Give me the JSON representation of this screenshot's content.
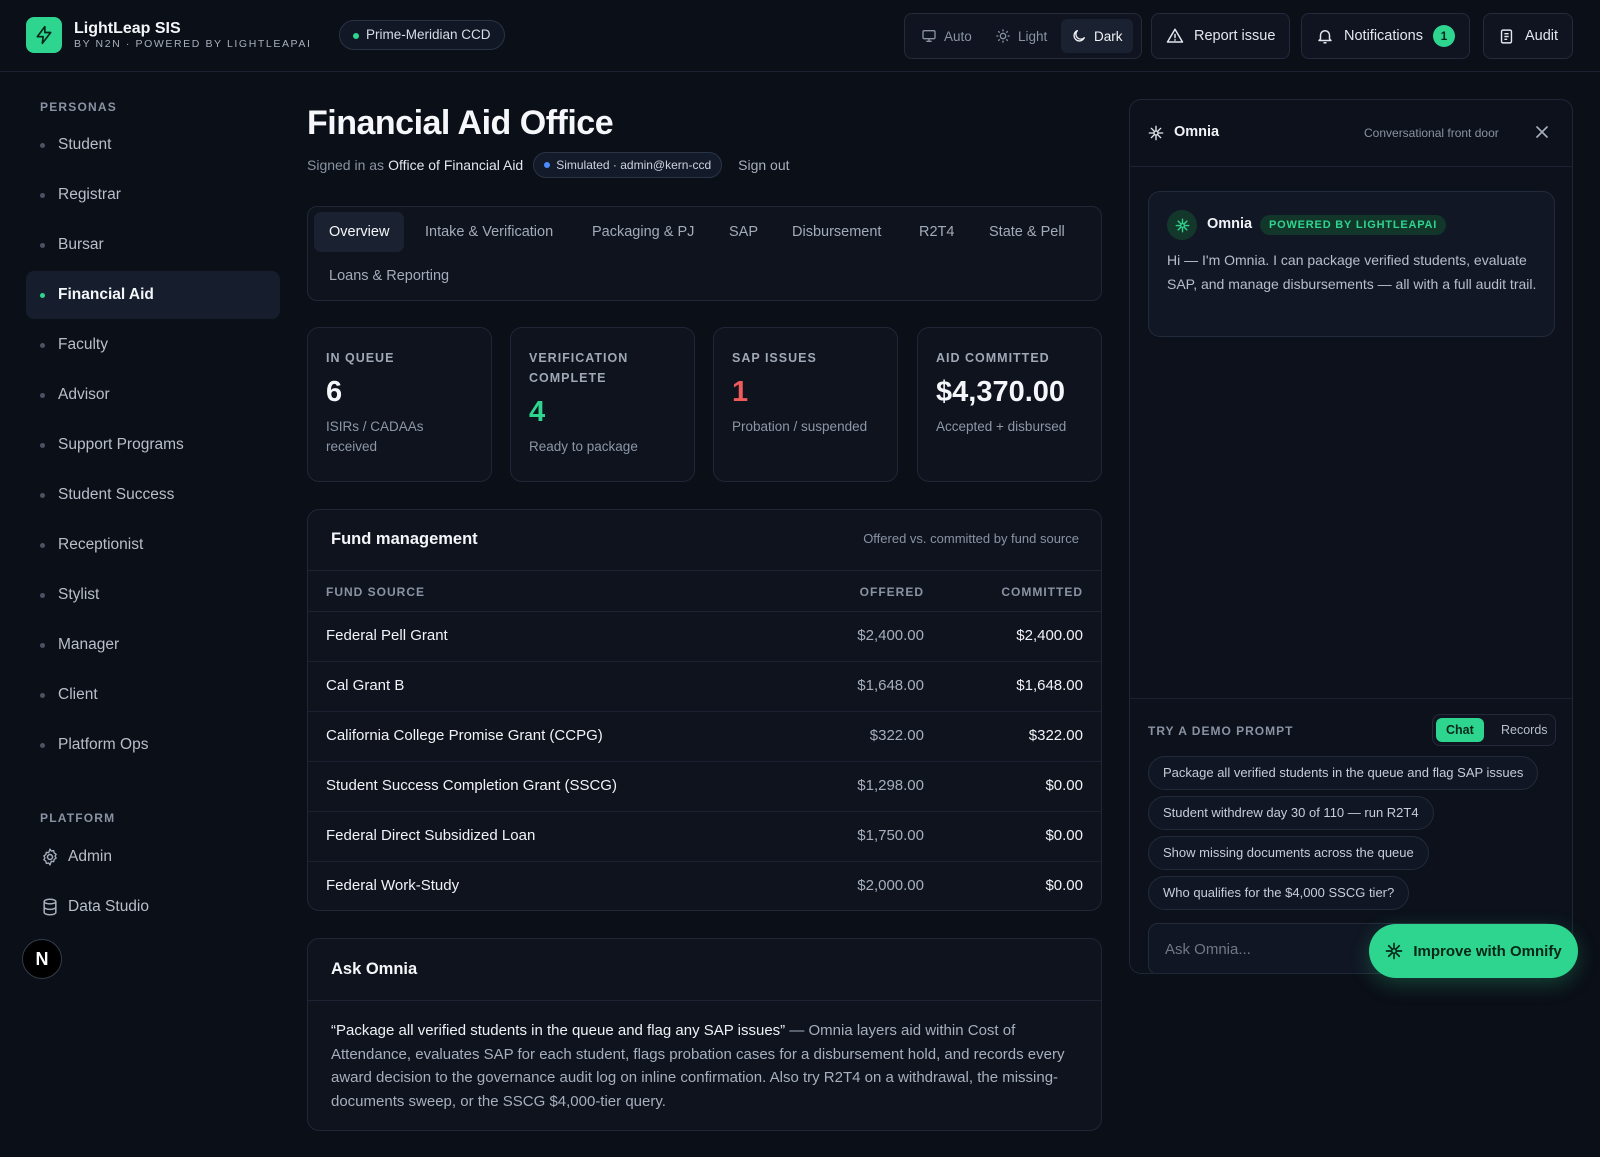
{
  "header": {
    "brand_name": "LightLeap SIS",
    "brand_sub": "BY N2N · POWERED BY LIGHTLEAPAI",
    "tenant": "Prime-Meridian CCD",
    "theme": {
      "auto": "Auto",
      "light": "Light",
      "dark": "Dark",
      "selected": "Dark"
    },
    "report_issue": "Report issue",
    "notifications": "Notifications",
    "notifications_count": "1",
    "audit": "Audit"
  },
  "sidebar": {
    "personas_label": "PERSONAS",
    "personas": [
      "Student",
      "Registrar",
      "Bursar",
      "Financial Aid",
      "Faculty",
      "Advisor",
      "Support Programs",
      "Student Success",
      "Receptionist",
      "Stylist",
      "Manager",
      "Client",
      "Platform Ops"
    ],
    "active": "Financial Aid",
    "platform_label": "PLATFORM",
    "platform": [
      "Admin",
      "Data Studio"
    ],
    "avatar_letter": "N"
  },
  "main": {
    "title": "Financial Aid Office",
    "signed_in_prefix": "Signed in as",
    "signed_in_as": "Office of Financial Aid",
    "simulated": "Simulated · admin@kern-ccd",
    "sign_out": "Sign out",
    "tabs": [
      "Overview",
      "Intake & Verification",
      "Packaging & PJ",
      "SAP",
      "Disbursement",
      "R2T4",
      "State & Pell",
      "Loans & Reporting"
    ],
    "active_tab": "Overview",
    "kpis": [
      {
        "label": "IN QUEUE",
        "value": "6",
        "sub": "ISIRs / CADAAs received"
      },
      {
        "label": "VERIFICATION COMPLETE",
        "value": "4",
        "sub": "Ready to package"
      },
      {
        "label": "SAP ISSUES",
        "value": "1",
        "sub": "Probation / suspended"
      },
      {
        "label": "AID COMMITTED",
        "value": "$4,370.00",
        "sub": "Accepted + disbursed"
      }
    ],
    "fund": {
      "title": "Fund management",
      "note": "Offered vs. committed by fund source",
      "columns": [
        "FUND SOURCE",
        "OFFERED",
        "COMMITTED"
      ],
      "rows": [
        {
          "source": "Federal Pell Grant",
          "offered": "$2,400.00",
          "committed": "$2,400.00"
        },
        {
          "source": "Cal Grant B",
          "offered": "$1,648.00",
          "committed": "$1,648.00"
        },
        {
          "source": "California College Promise Grant (CCPG)",
          "offered": "$322.00",
          "committed": "$322.00"
        },
        {
          "source": "Student Success Completion Grant (SSCG)",
          "offered": "$1,298.00",
          "committed": "$0.00"
        },
        {
          "source": "Federal Direct Subsidized Loan",
          "offered": "$1,750.00",
          "committed": "$0.00"
        },
        {
          "source": "Federal Work-Study",
          "offered": "$2,000.00",
          "committed": "$0.00"
        }
      ]
    },
    "ask": {
      "title": "Ask Omnia",
      "quote": "“Package all verified students in the queue and flag any SAP issues”",
      "body": " — Omnia layers aid within Cost of Attendance, evaluates SAP for each student, flags probation cases for a disbursement hold, and records every award decision to the governance audit log on inline confirmation. Also try R2T4 on a withdrawal, the missing-documents sweep, or the SSCG $4,000-tier query."
    }
  },
  "omnia": {
    "title": "Omnia",
    "note": "Conversational front door",
    "bubble_name": "Omnia",
    "bubble_tag": "POWERED BY LIGHTLEAPAI",
    "bubble_text": "Hi — I'm Omnia. I can package verified students, evaluate SAP, and manage disbursements — all with a full audit trail.",
    "demo_label": "TRY A DEMO PROMPT",
    "mode": {
      "chat": "Chat",
      "records": "Records",
      "selected": "Chat"
    },
    "prompts": [
      "Package all verified students in the queue and flag SAP issues",
      "Student withdrew day 30 of 110 — run R2T4",
      "Show missing documents across the queue",
      "Who qualifies for the $4,000 SSCG tier?"
    ],
    "input_placeholder": "Ask Omnia...",
    "improve_button": "Improve with Omnify"
  },
  "colors": {
    "accent": "#2ed58f",
    "background": "#0b0f17",
    "danger": "#ef5a5a"
  }
}
